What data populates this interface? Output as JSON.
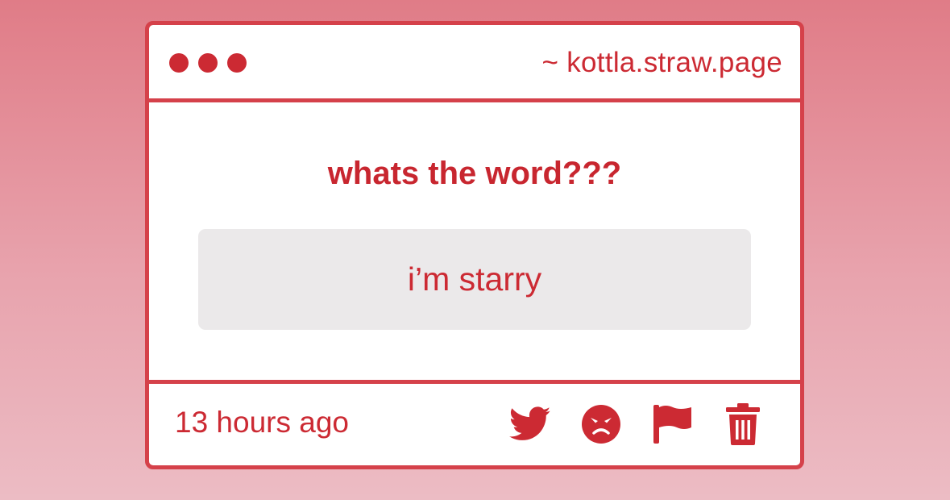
{
  "window": {
    "url": "~ kottla.straw.page"
  },
  "message": {
    "question": "whats the word???",
    "answer": "i’m starry"
  },
  "footer": {
    "timestamp": "13 hours ago",
    "actions": [
      {
        "icon": "twitter-icon"
      },
      {
        "icon": "angry-face-icon"
      },
      {
        "icon": "flag-icon"
      },
      {
        "icon": "trash-icon"
      }
    ]
  },
  "colors": {
    "accent": "#cc2a33",
    "border": "#d5414a",
    "answer_background": "#ebe9ea",
    "page_background_top": "#e07c87",
    "page_background_bottom": "#ecbcc4"
  }
}
